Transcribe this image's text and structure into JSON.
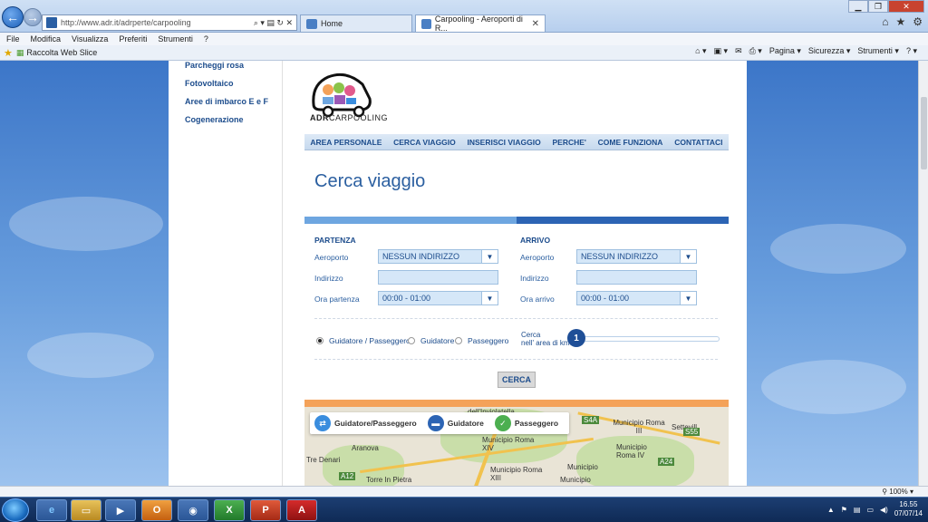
{
  "browser": {
    "address": "http://www.adr.it/adrperte/carpooling",
    "address_ctrls": "⌕ ▾ ▤ ↻ ✕",
    "tabs": [
      {
        "label": "Home"
      },
      {
        "label": "Carpooling - Aeroporti di R..."
      }
    ],
    "menu": [
      "File",
      "Modifica",
      "Visualizza",
      "Preferiti",
      "Strumenti",
      "?"
    ],
    "favorites": {
      "web_slice": "Raccolta Web Slice"
    },
    "commands": [
      "Pagina ▾",
      "Sicurezza ▾",
      "Strumenti ▾"
    ],
    "zoom": "100%"
  },
  "sidebar": {
    "items": [
      "Parcheggi rosa",
      "Fotovoltaico",
      "Aree di imbarco E e F",
      "Cogenerazione"
    ]
  },
  "logo": {
    "brand": "ADR",
    "product": "CARPOOLING"
  },
  "nav": [
    "AREA PERSONALE",
    "CERCA VIAGGIO",
    "INSERISCI VIAGGIO",
    "PERCHE'",
    "COME FUNZIONA",
    "CONTATTACI"
  ],
  "page_title": "Cerca viaggio",
  "progress_fraction": 0.5,
  "partenza": {
    "title": "PARTENZA",
    "aeroporto_label": "Aeroporto",
    "aeroporto_value": "NESSUN INDIRIZZO",
    "indirizzo_label": "Indirizzo",
    "ora_label": "Ora partenza",
    "ora_value": "00:00 - 01:00"
  },
  "arrivo": {
    "title": "ARRIVO",
    "aeroporto_label": "Aeroporto",
    "aeroporto_value": "NESSUN INDIRIZZO",
    "indirizzo_label": "Indirizzo",
    "ora_label": "Ora arrivo",
    "ora_value": "00:00 - 01:00"
  },
  "role_options": [
    "Guidatore / Passeggero",
    "Guidatore",
    "Passeggero"
  ],
  "role_selected": "Guidatore / Passeggero",
  "km": {
    "label_line1": "Cerca",
    "label_line2": "nell' area di km",
    "value": "1"
  },
  "search_button": "CERCA",
  "map": {
    "legend": [
      "Guidatore/Passeggero",
      "Guidatore",
      "Passeggero"
    ],
    "places": [
      "dell'Inviolatella",
      "Settevill",
      "Municipio Roma III",
      "Municipio Roma XIV",
      "Municipio Roma IV",
      "Aranova",
      "Tre Denari",
      "Torre In Pietra",
      "Municipio Roma XIII",
      "Municipio",
      "Municipio"
    ],
    "roads": [
      "S4A",
      "A12",
      "S55",
      "A24"
    ]
  },
  "taskbar": {
    "time": "16.55",
    "date": "07/07/14"
  },
  "colors": {
    "accent": "#2b5fa0",
    "nav_bg": "#c6d9ee",
    "progress_light": "#6ea6e0",
    "progress_dark": "#2c64b4"
  }
}
